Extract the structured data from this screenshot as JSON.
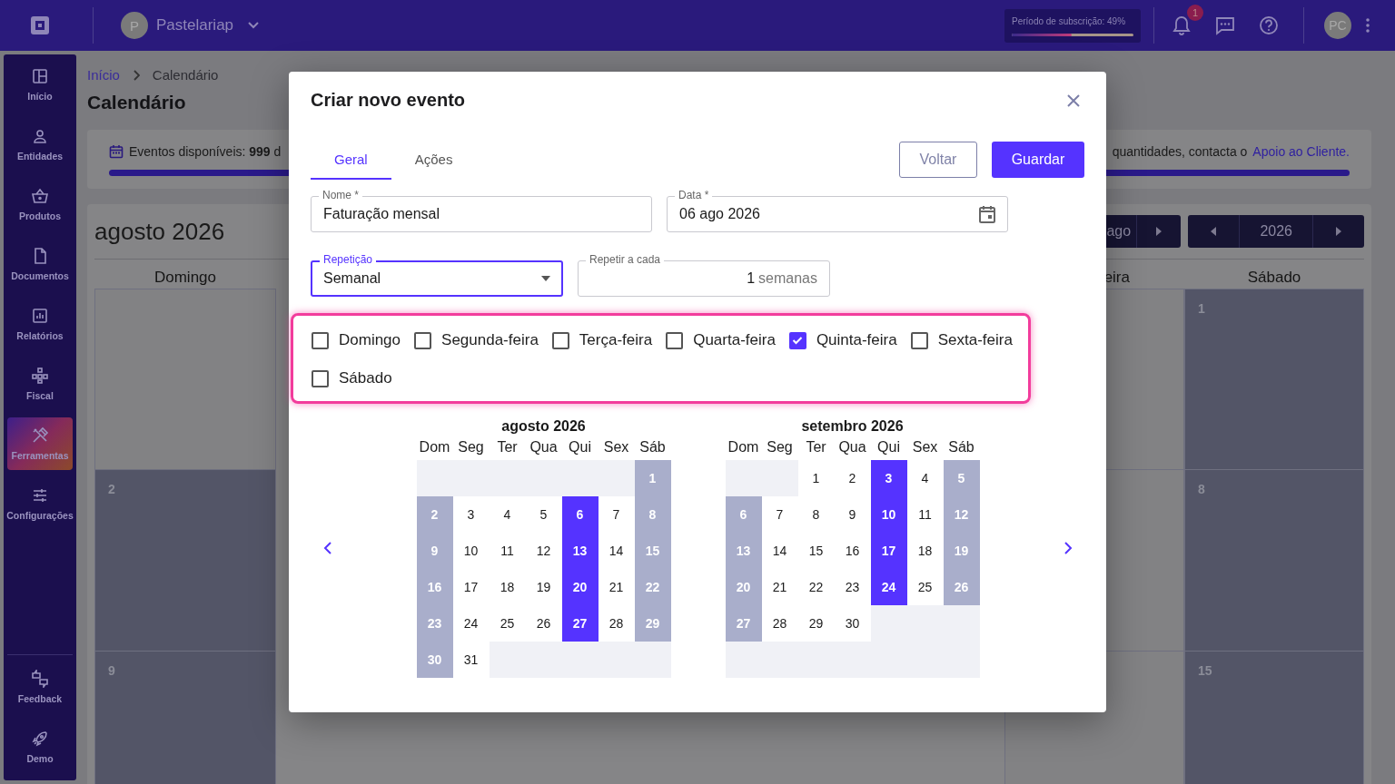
{
  "topbar": {
    "company_initial": "P",
    "company": "Pastelariap",
    "subscription": {
      "label": "Período de subscrição: 49%",
      "level": 0.49
    },
    "notifications_badge": "1",
    "user_initials": "PC"
  },
  "sidebar": {
    "items": [
      {
        "label": "Início",
        "selected": false
      },
      {
        "label": "Entidades",
        "selected": false
      },
      {
        "label": "Produtos",
        "selected": false
      },
      {
        "label": "Documentos",
        "selected": false
      },
      {
        "label": "Relatórios",
        "selected": false
      },
      {
        "label": "Fiscal",
        "selected": false
      },
      {
        "label": "Ferramentas",
        "selected": true
      },
      {
        "label": "Configurações",
        "selected": false
      }
    ],
    "bottom_items": [
      {
        "label": "Feedback"
      },
      {
        "label": "Demo"
      }
    ]
  },
  "breadcrumb": [
    "Início",
    "Calendário"
  ],
  "page_title": "Calendário",
  "events_card": {
    "left_text": "Eventos disponíveis: **999** d",
    "right_text": "quantidades, contacta o",
    "link": "Apoio ao Cliente."
  },
  "calendar": {
    "title": "agosto 2026",
    "month_nav": "ago",
    "year_nav": "2026",
    "columns": [
      {
        "header": "Domingo",
        "cells": [
          {
            "weekend": false
          },
          {
            "day": "2",
            "weekend": true
          },
          {
            "day": "9",
            "weekend": true
          }
        ]
      },
      {
        "header": "eira",
        "cells": [
          {
            "weekend": false
          },
          {
            "weekend": false
          },
          {
            "weekend": false
          }
        ]
      },
      {
        "header": "Sábado",
        "cells": [
          {
            "day": "1",
            "weekend": true
          },
          {
            "day": "8",
            "weekend": true
          },
          {
            "day": "15",
            "weekend": true
          }
        ]
      }
    ]
  },
  "modal": {
    "title": "Criar novo evento",
    "tabs": [
      {
        "label": "Geral",
        "selected": true
      },
      {
        "label": "Ações",
        "selected": false
      }
    ],
    "buttons": {
      "back": "Voltar",
      "save": "Guardar"
    },
    "fields": {
      "name": {
        "label": "Nome *",
        "value": "Faturação mensal"
      },
      "date": {
        "label": "Data *",
        "value": "06 ago 2026"
      },
      "repetition": {
        "label": "Repetição",
        "value": "Semanal"
      },
      "repeat_every": {
        "label": "Repetir a cada",
        "value": "1",
        "suffix": "semanas"
      }
    },
    "weekdays": [
      {
        "label": "Domingo",
        "checked": false
      },
      {
        "label": "Segunda-feira",
        "checked": false
      },
      {
        "label": "Terça-feira",
        "checked": false
      },
      {
        "label": "Quarta-feira",
        "checked": false
      },
      {
        "label": "Quinta-feira",
        "checked": true
      },
      {
        "label": "Sexta-feira",
        "checked": false
      },
      {
        "label": "Sábado",
        "checked": false
      }
    ],
    "months": [
      {
        "title": "agosto 2026",
        "weekday_headers": [
          "Dom",
          "Seg",
          "Ter",
          "Qua",
          "Qui",
          "Sex",
          "Sáb"
        ],
        "weeks": [
          [
            {
              "kind": "blank"
            },
            {
              "kind": "blank"
            },
            {
              "kind": "blank"
            },
            {
              "kind": "blank"
            },
            {
              "kind": "blank"
            },
            {
              "kind": "blank"
            },
            {
              "kind": "day",
              "day": "1",
              "weekend": true,
              "selected": false
            }
          ],
          [
            {
              "kind": "day",
              "day": "2",
              "weekend": true,
              "selected": false
            },
            {
              "kind": "day",
              "day": "3",
              "weekend": false,
              "selected": false
            },
            {
              "kind": "day",
              "day": "4",
              "weekend": false,
              "selected": false
            },
            {
              "kind": "day",
              "day": "5",
              "weekend": false,
              "selected": false
            },
            {
              "kind": "day",
              "day": "6",
              "weekend": false,
              "selected": true
            },
            {
              "kind": "day",
              "day": "7",
              "weekend": false,
              "selected": false
            },
            {
              "kind": "day",
              "day": "8",
              "weekend": true,
              "selected": false
            }
          ],
          [
            {
              "kind": "day",
              "day": "9",
              "weekend": true,
              "selected": false
            },
            {
              "kind": "day",
              "day": "10",
              "weekend": false,
              "selected": false
            },
            {
              "kind": "day",
              "day": "11",
              "weekend": false,
              "selected": false
            },
            {
              "kind": "day",
              "day": "12",
              "weekend": false,
              "selected": false
            },
            {
              "kind": "day",
              "day": "13",
              "weekend": false,
              "selected": true
            },
            {
              "kind": "day",
              "day": "14",
              "weekend": false,
              "selected": false
            },
            {
              "kind": "day",
              "day": "15",
              "weekend": true,
              "selected": false
            }
          ],
          [
            {
              "kind": "day",
              "day": "16",
              "weekend": true,
              "selected": false
            },
            {
              "kind": "day",
              "day": "17",
              "weekend": false,
              "selected": false
            },
            {
              "kind": "day",
              "day": "18",
              "weekend": false,
              "selected": false
            },
            {
              "kind": "day",
              "day": "19",
              "weekend": false,
              "selected": false
            },
            {
              "kind": "day",
              "day": "20",
              "weekend": false,
              "selected": true
            },
            {
              "kind": "day",
              "day": "21",
              "weekend": false,
              "selected": false
            },
            {
              "kind": "day",
              "day": "22",
              "weekend": true,
              "selected": false
            }
          ],
          [
            {
              "kind": "day",
              "day": "23",
              "weekend": true,
              "selected": false
            },
            {
              "kind": "day",
              "day": "24",
              "weekend": false,
              "selected": false
            },
            {
              "kind": "day",
              "day": "25",
              "weekend": false,
              "selected": false
            },
            {
              "kind": "day",
              "day": "26",
              "weekend": false,
              "selected": false
            },
            {
              "kind": "day",
              "day": "27",
              "weekend": false,
              "selected": true
            },
            {
              "kind": "day",
              "day": "28",
              "weekend": false,
              "selected": false
            },
            {
              "kind": "day",
              "day": "29",
              "weekend": true,
              "selected": false
            }
          ],
          [
            {
              "kind": "day",
              "day": "30",
              "weekend": true,
              "selected": false
            },
            {
              "kind": "day",
              "day": "31",
              "weekend": false,
              "selected": false
            },
            {
              "kind": "blank"
            },
            {
              "kind": "blank"
            },
            {
              "kind": "blank"
            },
            {
              "kind": "blank"
            },
            {
              "kind": "blank"
            }
          ]
        ]
      },
      {
        "title": "setembro 2026",
        "weekday_headers": [
          "Dom",
          "Seg",
          "Ter",
          "Qua",
          "Qui",
          "Sex",
          "Sáb"
        ],
        "weeks": [
          [
            {
              "kind": "blank"
            },
            {
              "kind": "blank"
            },
            {
              "kind": "day",
              "day": "1",
              "weekend": false,
              "selected": false
            },
            {
              "kind": "day",
              "day": "2",
              "weekend": false,
              "selected": false
            },
            {
              "kind": "day",
              "day": "3",
              "weekend": false,
              "selected": true
            },
            {
              "kind": "day",
              "day": "4",
              "weekend": false,
              "selected": false
            },
            {
              "kind": "day",
              "day": "5",
              "weekend": true,
              "selected": false
            }
          ],
          [
            {
              "kind": "day",
              "day": "6",
              "weekend": true,
              "selected": false
            },
            {
              "kind": "day",
              "day": "7",
              "weekend": false,
              "selected": false
            },
            {
              "kind": "day",
              "day": "8",
              "weekend": false,
              "selected": false
            },
            {
              "kind": "day",
              "day": "9",
              "weekend": false,
              "selected": false
            },
            {
              "kind": "day",
              "day": "10",
              "weekend": false,
              "selected": true
            },
            {
              "kind": "day",
              "day": "11",
              "weekend": false,
              "selected": false
            },
            {
              "kind": "day",
              "day": "12",
              "weekend": true,
              "selected": false
            }
          ],
          [
            {
              "kind": "day",
              "day": "13",
              "weekend": true,
              "selected": false
            },
            {
              "kind": "day",
              "day": "14",
              "weekend": false,
              "selected": false
            },
            {
              "kind": "day",
              "day": "15",
              "weekend": false,
              "selected": false
            },
            {
              "kind": "day",
              "day": "16",
              "weekend": false,
              "selected": false
            },
            {
              "kind": "day",
              "day": "17",
              "weekend": false,
              "selected": true
            },
            {
              "kind": "day",
              "day": "18",
              "weekend": false,
              "selected": false
            },
            {
              "kind": "day",
              "day": "19",
              "weekend": true,
              "selected": false
            }
          ],
          [
            {
              "kind": "day",
              "day": "20",
              "weekend": true,
              "selected": false
            },
            {
              "kind": "day",
              "day": "21",
              "weekend": false,
              "selected": false
            },
            {
              "kind": "day",
              "day": "22",
              "weekend": false,
              "selected": false
            },
            {
              "kind": "day",
              "day": "23",
              "weekend": false,
              "selected": false
            },
            {
              "kind": "day",
              "day": "24",
              "weekend": false,
              "selected": true
            },
            {
              "kind": "day",
              "day": "25",
              "weekend": false,
              "selected": false
            },
            {
              "kind": "day",
              "day": "26",
              "weekend": true,
              "selected": false
            }
          ],
          [
            {
              "kind": "day",
              "day": "27",
              "weekend": true,
              "selected": false
            },
            {
              "kind": "day",
              "day": "28",
              "weekend": false,
              "selected": false
            },
            {
              "kind": "day",
              "day": "29",
              "weekend": false,
              "selected": false
            },
            {
              "kind": "day",
              "day": "30",
              "weekend": false,
              "selected": false
            },
            {
              "kind": "blank"
            },
            {
              "kind": "blank"
            },
            {
              "kind": "blank"
            }
          ],
          [
            {
              "kind": "blank"
            },
            {
              "kind": "blank"
            },
            {
              "kind": "blank"
            },
            {
              "kind": "blank"
            },
            {
              "kind": "blank"
            },
            {
              "kind": "blank"
            },
            {
              "kind": "blank"
            }
          ]
        ]
      }
    ]
  }
}
